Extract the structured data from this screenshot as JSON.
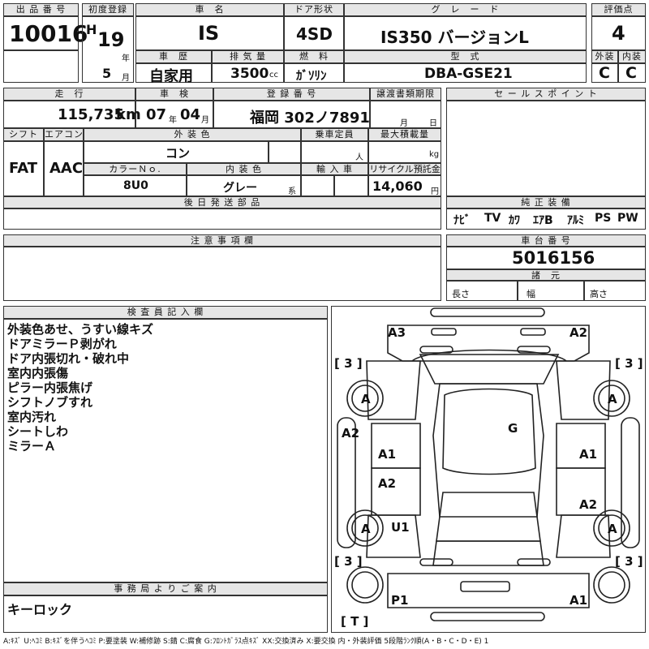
{
  "header": {
    "lot_label": "出 品 番 号",
    "lot_number": "10016",
    "first_reg_label": "初度登録",
    "era": "H",
    "first_reg_year": "19",
    "year_unit": "年",
    "first_reg_month": "5",
    "month_unit": "月",
    "car_name_label": "車　名",
    "car_name": "IS",
    "door_label": "ドア形状",
    "door_type": "4SD",
    "grade_label": "グ　レ　ー　ド",
    "grade": "IS350 バージョンL",
    "score_label": "評価点",
    "score": "4",
    "history_label": "車　歴",
    "history": "自家用",
    "displacement_label": "排 気 量",
    "displacement": "3500",
    "displacement_unit": "cc",
    "fuel_label": "燃　料",
    "fuel": "ｶﾞｿﾘﾝ",
    "model_label": "型　式",
    "model_code": "DBA-GSE21",
    "exterior_score_label": "外装",
    "exterior_score": "C",
    "interior_score_label": "内装",
    "interior_score": "C"
  },
  "details": {
    "mileage_label": "走　行",
    "mileage": "115,735",
    "mileage_unit": "km",
    "inspection_label": "車　検",
    "inspection_year": "07",
    "inspection_month": "04",
    "year_unit": "年",
    "month_unit": "月",
    "registration_label": "登 録 番 号",
    "registration": "福岡 302ノ7891",
    "transfer_label": "譲渡書類期限",
    "transfer_month_unit": "月",
    "transfer_day_unit": "日",
    "shift_label": "シフト",
    "shift": "FAT",
    "aircon_label": "エアコン",
    "aircon": "AAC",
    "ext_color_label": "外 装 色",
    "ext_color": "コン",
    "capacity_label": "乗車定員",
    "capacity_unit": "人",
    "max_load_label": "最大積載量",
    "max_load_unit": "kg",
    "color_no_label": "カラーＮｏ.",
    "color_no": "8U0",
    "int_color_label": "内 装 色",
    "int_color": "グレー",
    "int_color_unit": "系",
    "import_label": "輸 入 車",
    "recycle_label": "リサイクル預託金",
    "recycle_fee": "14,060",
    "recycle_unit": "円",
    "later_parts_label": "後 日 発 送 部 品",
    "sales_point_label": "セ ー ル ス ポ イ ン ト",
    "genuine_label": "純 正 装 備",
    "equipment": [
      "ﾅﾋﾞ",
      "TV",
      "ｶﾜ",
      "ｴｱB",
      "ｱﾙﾐ",
      "PS",
      "PW"
    ],
    "notes_label": "注 意 事 項 欄",
    "chassis_label": "車 台 番 号",
    "chassis_number": "5016156",
    "dims_label": "諸　元",
    "length_label": "長さ",
    "width_label": "幅",
    "height_label": "高さ"
  },
  "inspector": {
    "label": "検 査 員 記 入 欄",
    "notes": [
      "外装色あせ、うすい線キズ",
      "ドアミラーＰ剥がれ",
      "ドア内張切れ・破れ中",
      "室内内張傷",
      "ピラー内張焦げ",
      "シフトノブすれ",
      "室内汚れ",
      "シートしわ",
      "ミラーＡ"
    ]
  },
  "office": {
    "label": "事 務 局 よ り ご 案 内",
    "note": "キーロック"
  },
  "diagram": {
    "marks": {
      "a3": "A3",
      "a2_tr": "A2",
      "tire_lf": "[ 3 ]",
      "tire_rf": "[ 3 ]",
      "wheel_lf": "A",
      "wheel_rf": "A",
      "roof": "G",
      "a2_left": "A2",
      "a1_left": "A1",
      "a1_right": "A1",
      "a2_ld": "A2",
      "a2_rd": "A2",
      "wheel_lr": "A",
      "wheel_rr": "A",
      "u1": "U1",
      "tire_lr": "[ 3 ]",
      "tire_rr": "[ 3 ]",
      "p1": "P1",
      "a1_rear": "A1",
      "spare": "[ T ]"
    }
  },
  "legend": "A:ｷｽﾞ U:ﾍｺﾐ B:ｷｽﾞを伴うﾍｺﾐ P:要塗装 W:補修跡 S:錆 C:腐食 G:ﾌﾛﾝﾄｶﾞﾗｽ点ｷｽﾞ XX:交換済み X:要交換 内・外装評価 5段階ﾗﾝｸ順(A・B・C・D・E) 1"
}
